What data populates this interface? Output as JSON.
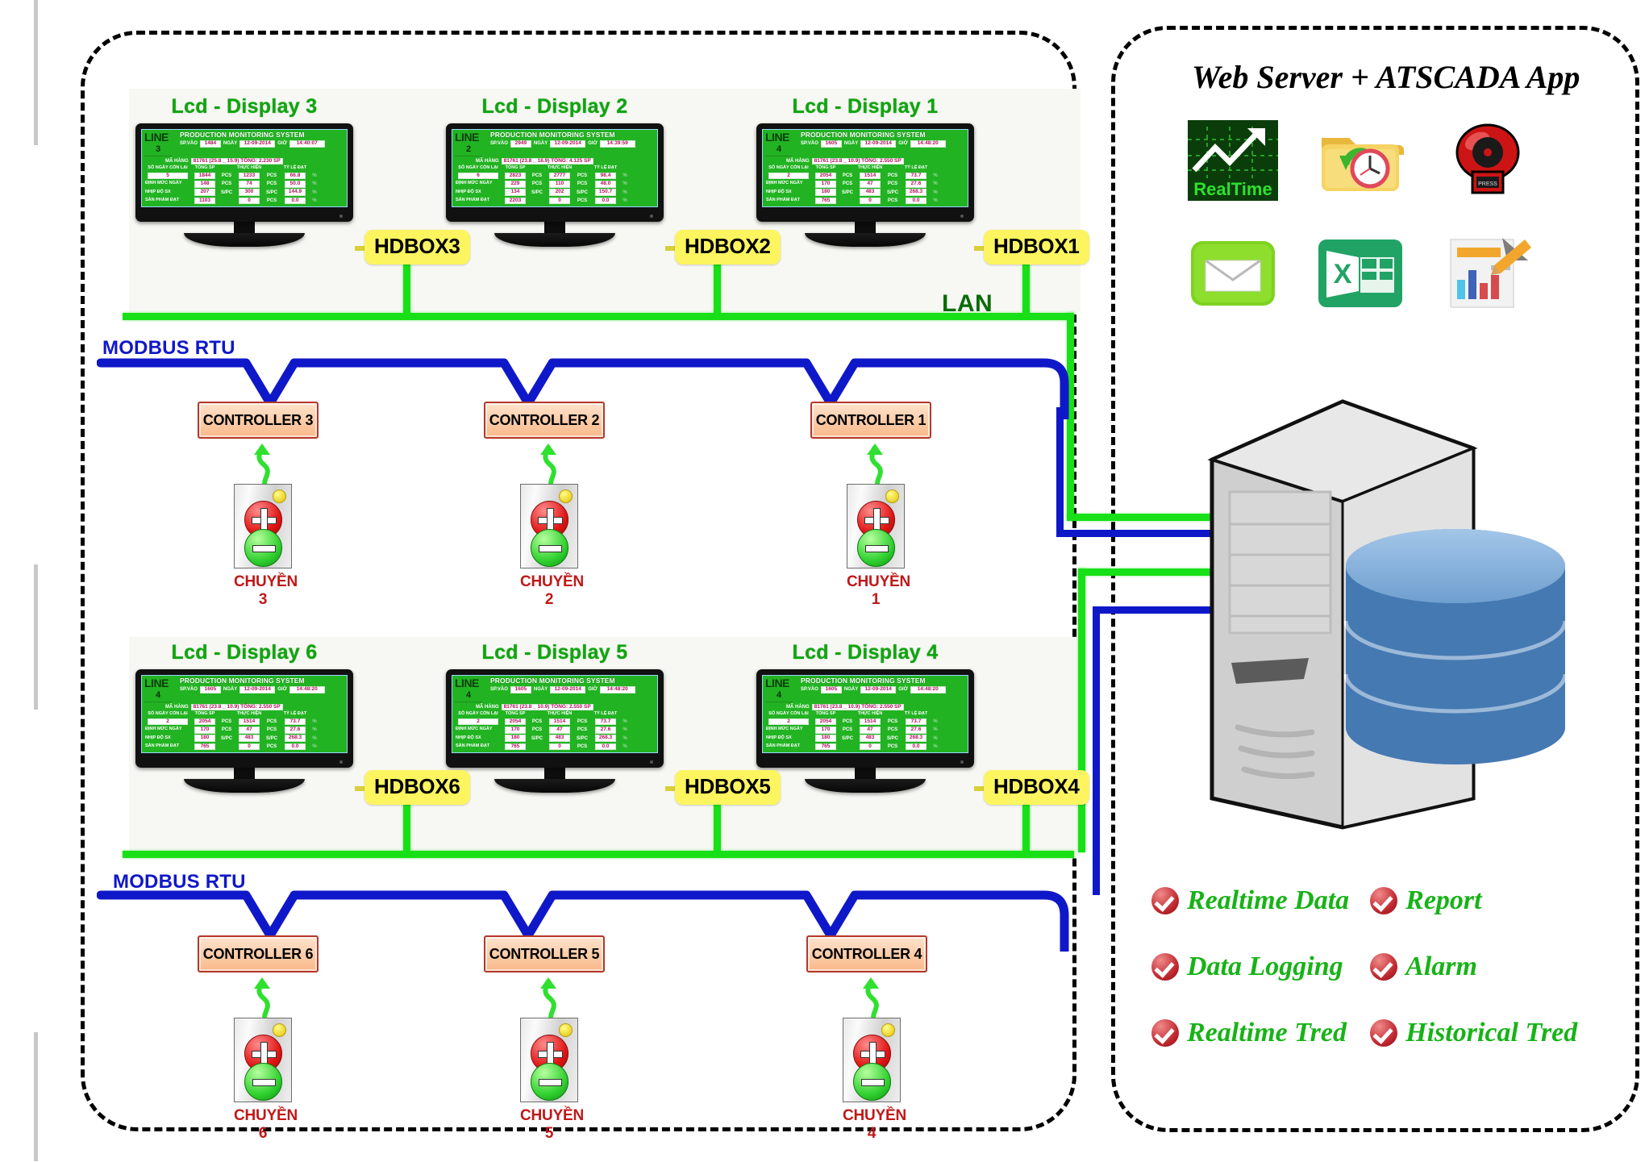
{
  "zones": {
    "plant_label": "plant-area",
    "server_label": "server-area"
  },
  "network": {
    "lan_label": "LAN",
    "modbus_label_top": "MODBUS RTU",
    "modbus_label_bottom": "MODBUS RTU"
  },
  "displays": [
    {
      "title": "Lcd - Display 3",
      "hdbox": "HDBOX3",
      "screen": {
        "line_word": "LINE",
        "line_no": "3",
        "header": "PRODUCTION MONITORING SYSTEM",
        "spvao_label": "SP.VÀO",
        "spvao": "1484",
        "ngay_label": "NGÀY",
        "ngay": "12-09-2014",
        "gio_label": "GIỜ",
        "gio": "14:40:07",
        "mahang_label": "MÃ HÀNG",
        "mahang": "81761 (25.8 _ 15.9) TỔNG: 2.230 SP",
        "col_left": "SỐ NGÀY CÒN LẠI",
        "col_tong": "TỔNG SP",
        "col_thuchien": "THỰC HIỆN",
        "col_tyle": "TỶ LỆ ĐẠT",
        "rows": [
          {
            "label": "",
            "v1": "5",
            "u1": "",
            "v2": "1844",
            "u2": "PCS",
            "v3": "1233",
            "u3": "PCS",
            "v4": "66.8",
            "pct": "%"
          },
          {
            "label": "ĐỊNH MỨC NGÀY",
            "v1": "",
            "u1": "",
            "v2": "148",
            "u2": "PCS",
            "v3": "74",
            "u3": "PCS",
            "v4": "50.0",
            "pct": "%"
          },
          {
            "label": "NHỊP ĐỘ SX",
            "v1": "",
            "u1": "",
            "v2": "207",
            "u2": "S/PC",
            "v3": "300",
            "u3": "S/PC",
            "v4": "144.9",
            "pct": "%"
          },
          {
            "label": "SẢN PHẨM ĐẠT",
            "v1": "",
            "u1": "",
            "v2": "1103",
            "u2": "",
            "v3": "0",
            "u3": "PCS",
            "v4": "0.0",
            "pct": "%"
          }
        ]
      }
    },
    {
      "title": "Lcd - Display 2",
      "hdbox": "HDBOX2",
      "screen": {
        "line_word": "LINE",
        "line_no": "2",
        "header": "PRODUCTION MONITORING SYSTEM",
        "spvao_label": "SP.VÀO",
        "spvao": "2949",
        "ngay_label": "NGÀY",
        "ngay": "12-09-2014",
        "gio_label": "GIỜ",
        "gio": "14:39:59",
        "mahang_label": "MÃ HÀNG",
        "mahang": "81761 (23.8 _ 16.9) TỔNG: 4.125 SP",
        "col_left": "SỐ NGÀY CÒN LẠI",
        "col_tong": "TỔNG SP",
        "col_thuchien": "THỰC HIỆN",
        "col_tyle": "TỶ LỆ ĐẠT",
        "rows": [
          {
            "label": "",
            "v1": "6",
            "u1": "",
            "v2": "2823",
            "u2": "PCS",
            "v3": "2777",
            "u3": "PCS",
            "v4": "98.4",
            "pct": "%"
          },
          {
            "label": "ĐỊNH MỨC NGÀY",
            "v1": "",
            "u1": "",
            "v2": "229",
            "u2": "PCS",
            "v3": "110",
            "u3": "PCS",
            "v4": "48.0",
            "pct": "%"
          },
          {
            "label": "NHỊP ĐỘ SX",
            "v1": "",
            "u1": "",
            "v2": "134",
            "u2": "S/PC",
            "v3": "202",
            "u3": "S/PC",
            "v4": "150.7",
            "pct": "%"
          },
          {
            "label": "SẢN PHẨM ĐẠT",
            "v1": "",
            "u1": "",
            "v2": "2203",
            "u2": "",
            "v3": "0",
            "u3": "PCS",
            "v4": "0.0",
            "pct": "%"
          }
        ]
      }
    },
    {
      "title": "Lcd - Display 1",
      "hdbox": "HDBOX1",
      "screen": {
        "line_word": "LINE",
        "line_no": "4",
        "header": "PRODUCTION MONITORING SYSTEM",
        "spvao_label": "SP.VÀO",
        "spvao": "1605",
        "ngay_label": "NGÀY",
        "ngay": "12-09-2014",
        "gio_label": "GIỜ",
        "gio": "14:48:20",
        "mahang_label": "MÃ HÀNG",
        "mahang": "81761 (23.8 _ 10.9) TỔNG: 2.550 SP",
        "col_left": "SỐ NGÀY CÒN LẠI",
        "col_tong": "TỔNG SP",
        "col_thuchien": "THỰC HIỆN",
        "col_tyle": "TỶ LỆ ĐẠT",
        "rows": [
          {
            "label": "",
            "v1": "2",
            "u1": "",
            "v2": "2054",
            "u2": "PCS",
            "v3": "1514",
            "u3": "PCS",
            "v4": "73.7",
            "pct": "%"
          },
          {
            "label": "ĐỊNH MỨC NGÀY",
            "v1": "",
            "u1": "",
            "v2": "170",
            "u2": "PCS",
            "v3": "47",
            "u3": "PCS",
            "v4": "27.6",
            "pct": "%"
          },
          {
            "label": "NHỊP ĐỘ SX",
            "v1": "",
            "u1": "",
            "v2": "180",
            "u2": "S/PC",
            "v3": "483",
            "u3": "S/PC",
            "v4": "268.3",
            "pct": "%"
          },
          {
            "label": "SẢN PHẨM ĐẠT",
            "v1": "",
            "u1": "",
            "v2": "765",
            "u2": "",
            "v3": "0",
            "u3": "PCS",
            "v4": "0.0",
            "pct": "%"
          }
        ]
      }
    },
    {
      "title": "Lcd - Display 6",
      "hdbox": "HDBOX6",
      "screen": {
        "line_word": "LINE",
        "line_no": "4",
        "header": "PRODUCTION MONITORING SYSTEM",
        "spvao_label": "SP.VÀO",
        "spvao": "1605",
        "ngay_label": "NGÀY",
        "ngay": "12-09-2014",
        "gio_label": "GIỜ",
        "gio": "14:48:20",
        "mahang_label": "MÃ HÀNG",
        "mahang": "81761 (23.8 _ 10.9) TỔNG: 2.550 SP",
        "col_left": "SỐ NGÀY CÒN LẠI",
        "col_tong": "TỔNG SP",
        "col_thuchien": "THỰC HIỆN",
        "col_tyle": "TỶ LỆ ĐẠT",
        "rows": [
          {
            "label": "",
            "v1": "2",
            "u1": "",
            "v2": "2054",
            "u2": "PCS",
            "v3": "1514",
            "u3": "PCS",
            "v4": "73.7",
            "pct": "%"
          },
          {
            "label": "ĐỊNH MỨC NGÀY",
            "v1": "",
            "u1": "",
            "v2": "170",
            "u2": "PCS",
            "v3": "47",
            "u3": "PCS",
            "v4": "27.6",
            "pct": "%"
          },
          {
            "label": "NHỊP ĐỘ SX",
            "v1": "",
            "u1": "",
            "v2": "180",
            "u2": "S/PC",
            "v3": "483",
            "u3": "S/PC",
            "v4": "268.3",
            "pct": "%"
          },
          {
            "label": "SẢN PHẨM ĐẠT",
            "v1": "",
            "u1": "",
            "v2": "765",
            "u2": "",
            "v3": "0",
            "u3": "PCS",
            "v4": "0.0",
            "pct": "%"
          }
        ]
      }
    },
    {
      "title": "Lcd - Display 5",
      "hdbox": "HDBOX5",
      "screen": {
        "line_word": "LINE",
        "line_no": "4",
        "header": "PRODUCTION MONITORING SYSTEM",
        "spvao_label": "SP.VÀO",
        "spvao": "1605",
        "ngay_label": "NGÀY",
        "ngay": "12-09-2014",
        "gio_label": "GIỜ",
        "gio": "14:48:20",
        "mahang_label": "MÃ HÀNG",
        "mahang": "81761 (23.8 _ 10.9) TỔNG: 2.550 SP",
        "col_left": "SỐ NGÀY CÒN LẠI",
        "col_tong": "TỔNG SP",
        "col_thuchien": "THỰC HIỆN",
        "col_tyle": "TỶ LỆ ĐẠT",
        "rows": [
          {
            "label": "",
            "v1": "2",
            "u1": "",
            "v2": "2054",
            "u2": "PCS",
            "v3": "1514",
            "u3": "PCS",
            "v4": "73.7",
            "pct": "%"
          },
          {
            "label": "ĐỊNH MỨC NGÀY",
            "v1": "",
            "u1": "",
            "v2": "170",
            "u2": "PCS",
            "v3": "47",
            "u3": "PCS",
            "v4": "27.6",
            "pct": "%"
          },
          {
            "label": "NHỊP ĐỘ SX",
            "v1": "",
            "u1": "",
            "v2": "180",
            "u2": "S/PC",
            "v3": "483",
            "u3": "S/PC",
            "v4": "268.3",
            "pct": "%"
          },
          {
            "label": "SẢN PHẨM ĐẠT",
            "v1": "",
            "u1": "",
            "v2": "765",
            "u2": "",
            "v3": "0",
            "u3": "PCS",
            "v4": "0.0",
            "pct": "%"
          }
        ]
      }
    },
    {
      "title": "Lcd - Display 4",
      "hdbox": "HDBOX4",
      "screen": {
        "line_word": "LINE",
        "line_no": "4",
        "header": "PRODUCTION MONITORING SYSTEM",
        "spvao_label": "SP.VÀO",
        "spvao": "1605",
        "ngay_label": "NGÀY",
        "ngay": "12-09-2014",
        "gio_label": "GIỜ",
        "gio": "14:48:20",
        "mahang_label": "MÃ HÀNG",
        "mahang": "81761 (23.8 _ 10.9) TỔNG: 2.550 SP",
        "col_left": "SỐ NGÀY CÒN LẠI",
        "col_tong": "TỔNG SP",
        "col_thuchien": "THỰC HIỆN",
        "col_tyle": "TỶ LỆ ĐẠT",
        "rows": [
          {
            "label": "",
            "v1": "2",
            "u1": "",
            "v2": "2054",
            "u2": "PCS",
            "v3": "1514",
            "u3": "PCS",
            "v4": "73.7",
            "pct": "%"
          },
          {
            "label": "ĐỊNH MỨC NGÀY",
            "v1": "",
            "u1": "",
            "v2": "170",
            "u2": "PCS",
            "v3": "47",
            "u3": "PCS",
            "v4": "27.6",
            "pct": "%"
          },
          {
            "label": "NHỊP ĐỘ SX",
            "v1": "",
            "u1": "",
            "v2": "180",
            "u2": "S/PC",
            "v3": "483",
            "u3": "S/PC",
            "v4": "268.3",
            "pct": "%"
          },
          {
            "label": "SẢN PHẨM ĐẠT",
            "v1": "",
            "u1": "",
            "v2": "765",
            "u2": "",
            "v3": "0",
            "u3": "PCS",
            "v4": "0.0",
            "pct": "%"
          }
        ]
      }
    }
  ],
  "controllers": [
    {
      "label": "CONTROLLER 3",
      "station": "CHUYỀN 3"
    },
    {
      "label": "CONTROLLER 2",
      "station": "CHUYỀN 2"
    },
    {
      "label": "CONTROLLER 1",
      "station": "CHUYỀN 1"
    },
    {
      "label": "CONTROLLER 6",
      "station": "CHUYỀN 6"
    },
    {
      "label": "CONTROLLER 5",
      "station": "CHUYỀN 5"
    },
    {
      "label": "CONTROLLER 4",
      "station": "CHUYỀN 4"
    }
  ],
  "server_panel": {
    "title": "Web Server + ATSCADA App",
    "icons": [
      {
        "name": "realtime-chart-icon",
        "caption": "RealTime"
      },
      {
        "name": "data-logging-folder-clock-icon",
        "caption": ""
      },
      {
        "name": "alarm-bell-icon",
        "caption": ""
      },
      {
        "name": "email-envelope-icon",
        "caption": ""
      },
      {
        "name": "excel-spreadsheet-icon",
        "caption": "X"
      },
      {
        "name": "report-document-icon",
        "caption": ""
      }
    ],
    "features": [
      "Realtime Data",
      "Report",
      "Data Logging",
      "Alarm",
      "Realtime Tred",
      "Historical Tred"
    ]
  },
  "colors": {
    "lan_green": "#18e018",
    "modbus_blue": "#0f18c8",
    "hdbox_yellow": "#fcf55f",
    "controller_orange": "#f9b98a",
    "chuyen_red": "#c01818",
    "feature_green": "#17b317"
  }
}
